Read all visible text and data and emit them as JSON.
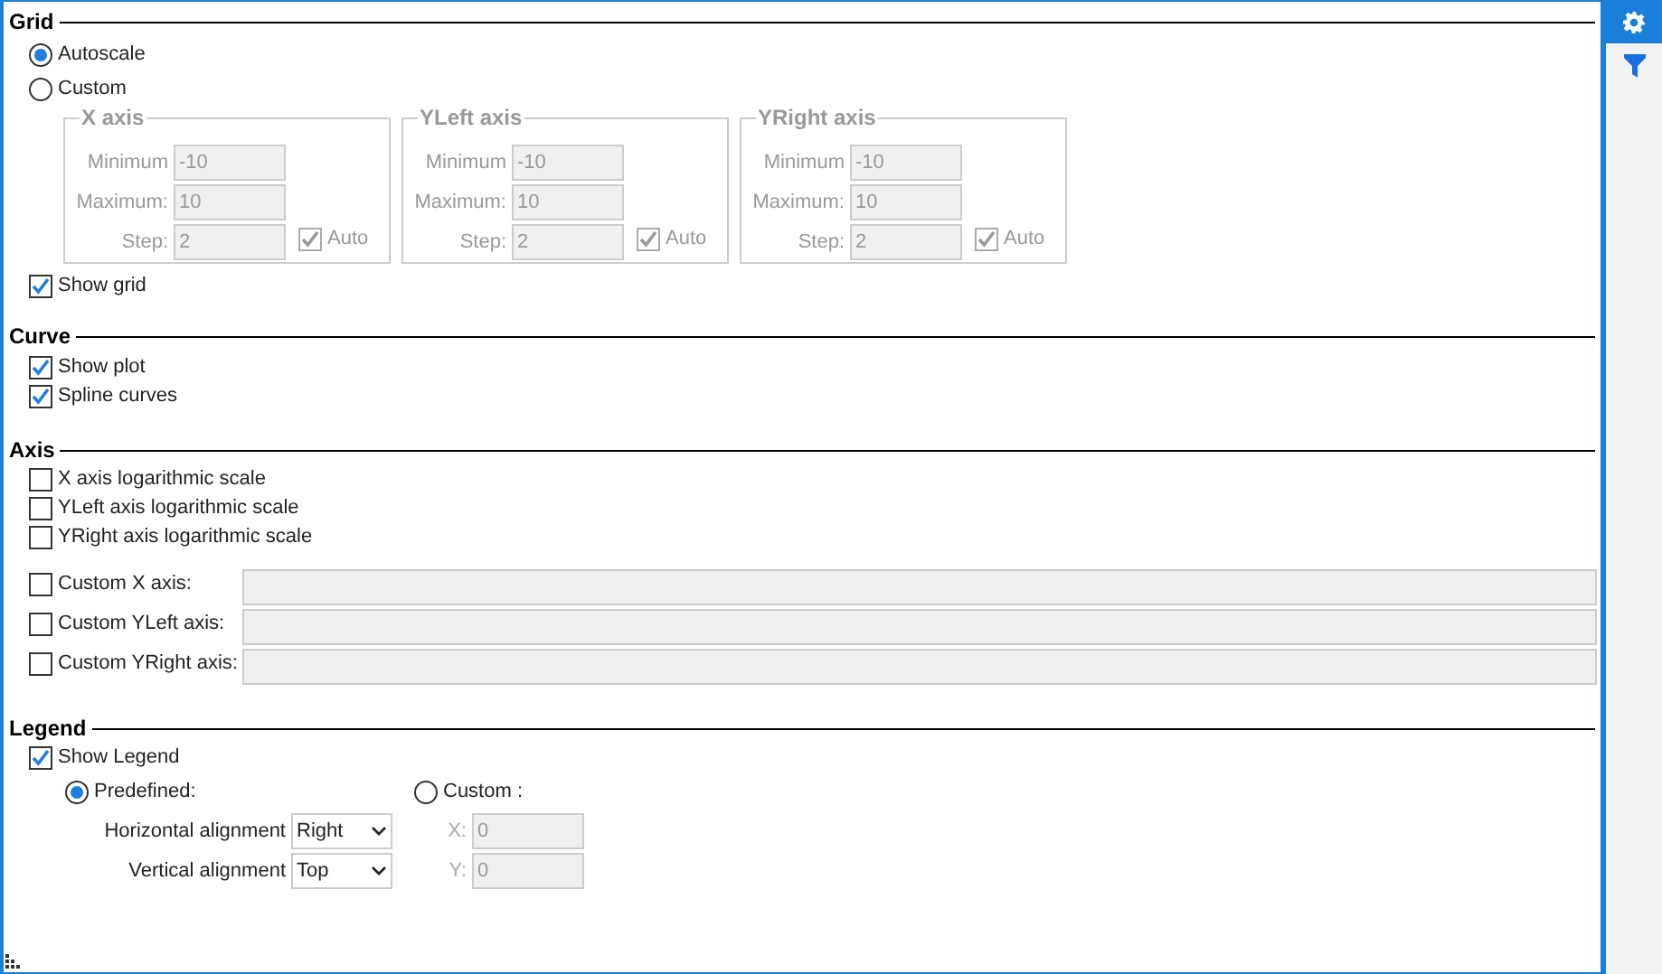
{
  "grid": {
    "title": "Grid",
    "modes": [
      {
        "label": "Autoscale",
        "selected": true
      },
      {
        "label": "Custom",
        "selected": false
      }
    ],
    "axes": [
      {
        "title": "X axis",
        "disabled": true,
        "fields": [
          {
            "label": "Minimum",
            "value": "-10"
          },
          {
            "label": "Maximum:",
            "value": "10"
          },
          {
            "label": "Step:",
            "value": "2"
          }
        ],
        "auto": {
          "label": "Auto",
          "checked": true
        }
      },
      {
        "title": "YLeft axis",
        "disabled": true,
        "fields": [
          {
            "label": "Minimum",
            "value": "-10"
          },
          {
            "label": "Maximum:",
            "value": "10"
          },
          {
            "label": "Step:",
            "value": "2"
          }
        ],
        "auto": {
          "label": "Auto",
          "checked": true
        }
      },
      {
        "title": "YRight axis",
        "disabled": true,
        "fields": [
          {
            "label": "Minimum",
            "value": "-10"
          },
          {
            "label": "Maximum:",
            "value": "10"
          },
          {
            "label": "Step:",
            "value": "2"
          }
        ],
        "auto": {
          "label": "Auto",
          "checked": true
        }
      }
    ],
    "show_grid": {
      "label": "Show grid",
      "checked": true
    }
  },
  "curve": {
    "title": "Curve",
    "options": [
      {
        "label": "Show plot",
        "checked": true
      },
      {
        "label": "Spline curves",
        "checked": true
      }
    ]
  },
  "axis": {
    "title": "Axis",
    "options": [
      {
        "label": "X axis logarithmic scale",
        "checked": false
      },
      {
        "label": "YLeft axis logarithmic scale",
        "checked": false
      },
      {
        "label": "YRight axis logarithmic scale",
        "checked": false
      }
    ],
    "custom_axes": [
      {
        "label": "Custom X axis:",
        "checked": false,
        "disabled": true
      },
      {
        "label": "Custom YLeft axis:",
        "checked": false,
        "disabled": true
      },
      {
        "label": "Custom YRight axis:",
        "checked": false,
        "disabled": true
      }
    ]
  },
  "legend": {
    "title": "Legend",
    "show_legend": {
      "label": "Show Legend",
      "checked": true
    },
    "modes": [
      {
        "label": "Predefined:",
        "selected": true
      },
      {
        "label": "Custom :",
        "selected": false
      }
    ],
    "alignments": [
      {
        "label": "Horizontal alignment",
        "value": "Right"
      },
      {
        "label": "Vertical alignment",
        "value": "Top"
      }
    ],
    "position": [
      {
        "label": "X:",
        "value": "0",
        "disabled": true
      },
      {
        "label": "Y:",
        "value": "0",
        "disabled": true
      }
    ]
  },
  "sidebar": {
    "buttons": [
      {
        "kind": "settings",
        "selected": true
      },
      {
        "kind": "filter",
        "selected": false
      }
    ]
  }
}
